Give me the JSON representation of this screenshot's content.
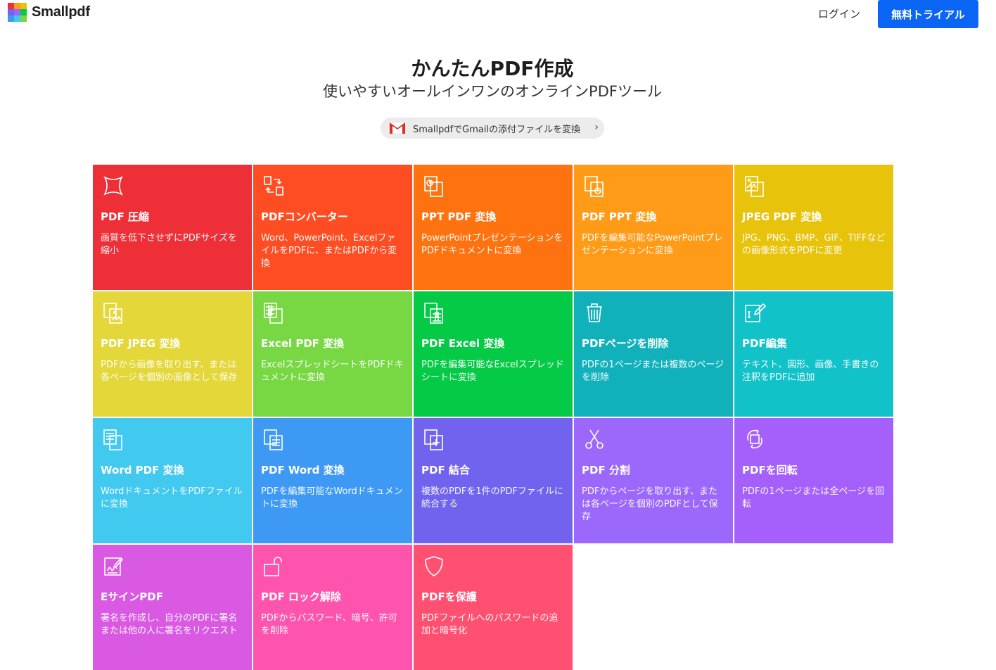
{
  "header": {
    "logo_text": "Smallpdf",
    "login_label": "ログイン",
    "trial_label": "無料トライアル"
  },
  "hero": {
    "title": "かんたんPDF作成",
    "subtitle": "使いやすいオールインワンのオンラインPDFツール",
    "gmail_link": "SmallpdfでGmailの添付ファイルを変換"
  },
  "tools": [
    {
      "title": "PDF 圧縮",
      "desc": "画質を低下させずにPDFサイズを縮小",
      "color": "#ef2f38",
      "icon": "compress-icon"
    },
    {
      "title": "PDFコンバーター",
      "desc": "Word、PowerPoint、ExcelファイルをPDFに、またはPDFから変換",
      "color": "#ff4d23",
      "icon": "converter-icon"
    },
    {
      "title": "PPT PDF 変換",
      "desc": "PowerPointプレゼンテーションをPDFドキュメントに変換",
      "color": "#ff7210",
      "icon": "ppt-to-pdf-icon"
    },
    {
      "title": "PDF PPT 変換",
      "desc": "PDFを編集可能なPowerPointプレゼンテーションに変換",
      "color": "#ff9b16",
      "icon": "pdf-to-ppt-icon"
    },
    {
      "title": "JPEG PDF 変換",
      "desc": "JPG、PNG、BMP、GIF、TIFFなどの画像形式をPDFに変更",
      "color": "#e8c30c",
      "icon": "jpg-to-pdf-icon"
    },
    {
      "title": "PDF JPEG 変換",
      "desc": "PDFから画像を取り出す、または各ページを個別の画像として保存",
      "color": "#e3d739",
      "icon": "pdf-to-jpg-icon"
    },
    {
      "title": "Excel PDF 変換",
      "desc": "ExcelスプレッドシートをPDFドキュメントに変換",
      "color": "#77d843",
      "icon": "excel-to-pdf-icon"
    },
    {
      "title": "PDF Excel 変換",
      "desc": "PDFを編集可能なExcelスプレッドシートに変換",
      "color": "#04ca45",
      "icon": "pdf-to-excel-icon"
    },
    {
      "title": "PDFページを削除",
      "desc": "PDFの1ページまたは複数のページを削除",
      "color": "#11b1bb",
      "icon": "trash-icon"
    },
    {
      "title": "PDF編集",
      "desc": "テキスト、図形、画像、手書きの注釈をPDFに追加",
      "color": "#12c2c9",
      "icon": "edit-icon"
    },
    {
      "title": "Word PDF 変換",
      "desc": "WordドキュメントをPDFファイルに変換",
      "color": "#41c9f0",
      "icon": "word-to-pdf-icon"
    },
    {
      "title": "PDF Word 変換",
      "desc": "PDFを編集可能なWordドキュメントに変換",
      "color": "#3d99f4",
      "icon": "pdf-to-word-icon"
    },
    {
      "title": "PDF 結合",
      "desc": "複数のPDFを1件のPDFファイルに統合する",
      "color": "#7163ee",
      "icon": "merge-icon"
    },
    {
      "title": "PDF 分割",
      "desc": "PDFからページを取り出す、または各ページを個別のPDFとして保存",
      "color": "#9b68fb",
      "icon": "scissors-icon"
    },
    {
      "title": "PDFを回転",
      "desc": "PDFの1ページまたは全ページを回転",
      "color": "#a560fb",
      "icon": "rotate-icon"
    },
    {
      "title": "EサインPDF",
      "desc": "署名を作成し、自分のPDFに署名または他の人に署名をリクエスト",
      "color": "#da59e3",
      "icon": "esign-icon"
    },
    {
      "title": "PDF ロック解除",
      "desc": "PDFからパスワード、暗号、許可を削除",
      "color": "#ff54ad",
      "icon": "unlock-icon"
    },
    {
      "title": "PDFを保護",
      "desc": "PDFファイルへのパスワードの追加と暗号化",
      "color": "#ff5071",
      "icon": "shield-icon"
    }
  ]
}
